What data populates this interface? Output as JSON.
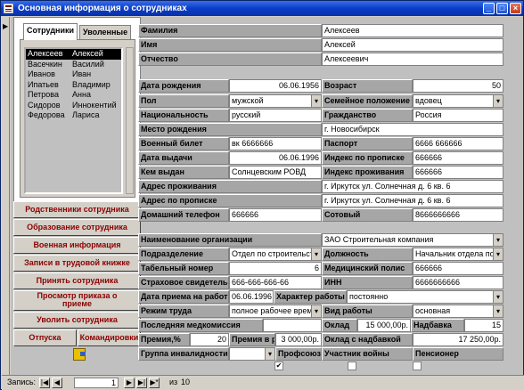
{
  "window": {
    "title": "Основная информация о сотрудниках",
    "min": "_",
    "max": "□",
    "close": "×"
  },
  "tabs": [
    "Сотрудники",
    "Уволенные"
  ],
  "employees": [
    [
      "Алексеев",
      "Алексей"
    ],
    [
      "Васечкин",
      "Василий"
    ],
    [
      "Иванов",
      "Иван"
    ],
    [
      "Ипатьев",
      "Владимир"
    ],
    [
      "Петрова",
      "Анна"
    ],
    [
      "Сидоров",
      "Иннокентий"
    ],
    [
      "Федорова",
      "Лариса"
    ]
  ],
  "buttons": {
    "relatives": "Родственники сотрудника",
    "education": "Образование сотрудника",
    "military": "Военная информация",
    "workbook": "Записи в трудовой книжке",
    "hire": "Принять сотрудника",
    "order1": "Просмотр приказа о",
    "order2": "приеме",
    "fire": "Уволить сотрудника",
    "vacation": "Отпуска",
    "trips": "Командировки"
  },
  "fields": {
    "surname_l": "Фамилия",
    "surname": "Алексеев",
    "name_l": "Имя",
    "name": "Алексей",
    "patr_l": "Отчество",
    "patr": "Алексеевич",
    "birth_l": "Дата рождения",
    "birth": "06.06.1956",
    "age_l": "Возраст",
    "age": "50",
    "sex_l": "Пол",
    "sex": "мужской",
    "family_l": "Семейное положение",
    "family": "вдовец",
    "nation_l": "Национальность",
    "nation": "русский",
    "citizen_l": "Гражданство",
    "citizen": "Россия",
    "bplace_l": "Место рождения",
    "bplace": "г. Новосибирск",
    "mil_l": "Военный билет",
    "mil": "вк 6666666",
    "pass_l": "Паспорт",
    "pass": "6666 666666",
    "issued_l": "Дата выдачи",
    "issued": "06.06.1996",
    "regidx_l": "Индекс по прописке",
    "regidx": "666666",
    "by_l": "Кем выдан",
    "by": "Солнцевским РОВД",
    "lividx_l": "Индекс проживания",
    "lividx": "666666",
    "liv_l": "Адрес проживания",
    "liv": "г. Иркутск ул. Солнечная д. 6 кв. 6",
    "reg_l": "Адрес по прописке",
    "reg": "г. Иркутск ул. Солнечная д. 6 кв. 6",
    "hphone_l": "Домашний телефон",
    "hphone": "666666",
    "mob_l": "Сотовый",
    "mob": "8666666666",
    "org_l": "Наименование организации",
    "org": "ЗАО Строительная компания",
    "dept_l": "Подразделение",
    "dept": "Отдел по строительст",
    "pos_l": "Должность",
    "pos": "Начальник отдела по стр",
    "tab_l": "Табельный номер",
    "tab": "6",
    "med_l": "Медицинский полис",
    "med": "666666",
    "ins_l": "Страховое свидетельство",
    "ins": "666-666-666-66",
    "inn_l": "ИНН",
    "inn": "6666666666",
    "hdate_l": "Дата приема на работу",
    "hdate": "06.06.1996",
    "wchar_l": "Характер работы",
    "wchar": "постоянно",
    "mode_l": "Режим труда",
    "mode": "полное рабочее врем",
    "wtype_l": "Вид работы",
    "wtype": "основная",
    "medc_l": "Последняя медкомиссия",
    "medc": "",
    "sal_l": "Оклад",
    "sal": "15 000,00р.",
    "bonus_l": "Надбавка",
    "bonus": "15",
    "prem_l": "Премия,%",
    "prem": "20",
    "premr_l": "Премия в р",
    "premr": "3 000,00р.",
    "total_l": "Оклад с надбавкой",
    "total": "17 250,00р.",
    "inv_l": "Группа инвалидности",
    "inv": "",
    "union_l": "Профсоюз",
    "vet_l": "Участник войны",
    "pens_l": "Пенсионер"
  },
  "nav": {
    "label": "Запись:",
    "current": "1",
    "of": "из",
    "total": "10"
  }
}
